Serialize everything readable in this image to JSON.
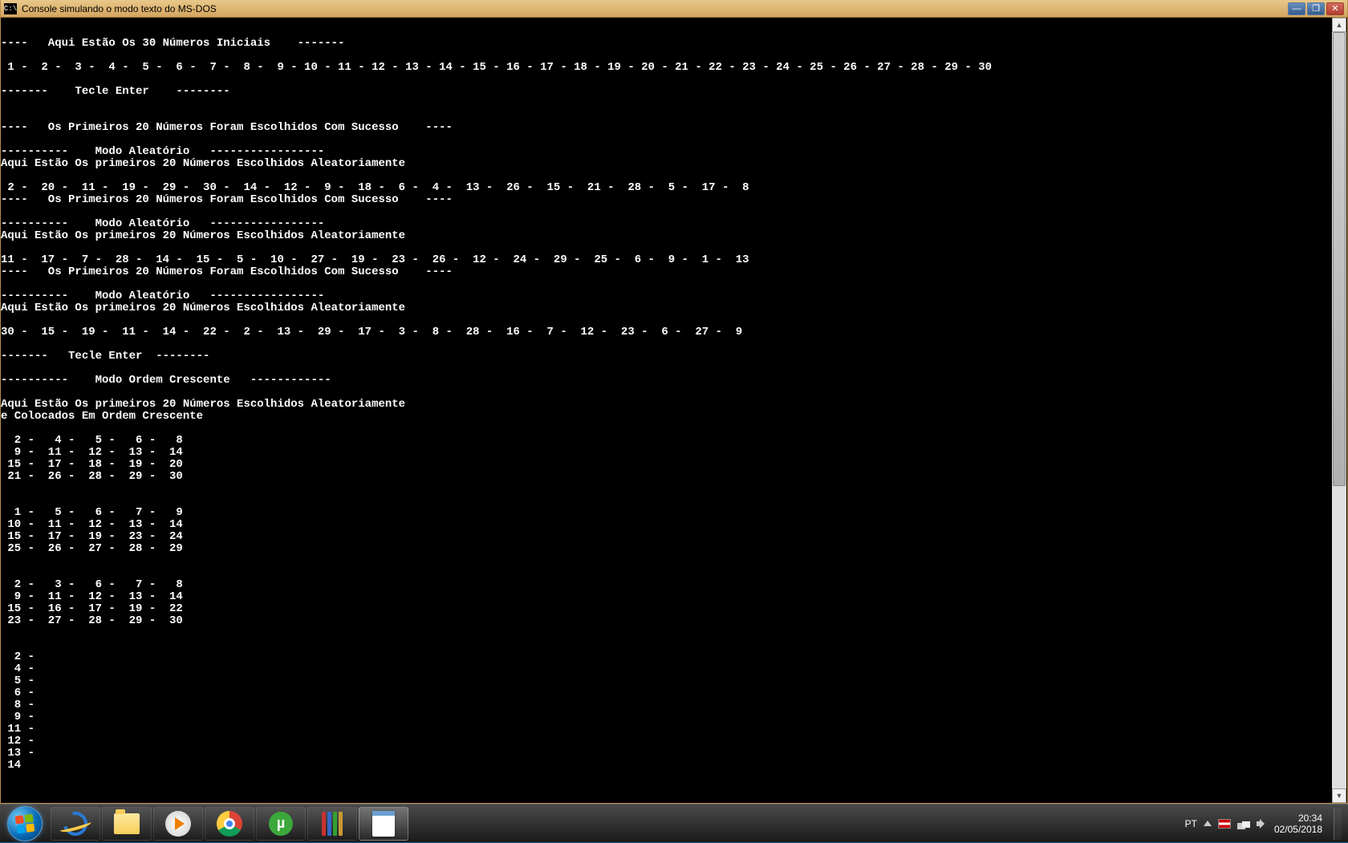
{
  "window": {
    "title": "Console simulando o modo texto do MS-DOS",
    "icon_text": "C:\\",
    "btn_min": "—",
    "btn_max": "❐",
    "btn_close": "✕"
  },
  "console_lines": [
    "",
    "----   Aqui Estão Os 30 Números Iniciais    -------",
    "",
    " 1 -  2 -  3 -  4 -  5 -  6 -  7 -  8 -  9 - 10 - 11 - 12 - 13 - 14 - 15 - 16 - 17 - 18 - 19 - 20 - 21 - 22 - 23 - 24 - 25 - 26 - 27 - 28 - 29 - 30",
    "",
    "-------    Tecle Enter    --------",
    "",
    "",
    "----   Os Primeiros 20 Números Foram Escolhidos Com Sucesso    ----",
    "",
    "----------    Modo Aleatório   -----------------",
    "Aqui Estão Os primeiros 20 Números Escolhidos Aleatoriamente",
    "",
    " 2 -  20 -  11 -  19 -  29 -  30 -  14 -  12 -  9 -  18 -  6 -  4 -  13 -  26 -  15 -  21 -  28 -  5 -  17 -  8",
    "----   Os Primeiros 20 Números Foram Escolhidos Com Sucesso    ----",
    "",
    "----------    Modo Aleatório   -----------------",
    "Aqui Estão Os primeiros 20 Números Escolhidos Aleatoriamente",
    "",
    "11 -  17 -  7 -  28 -  14 -  15 -  5 -  10 -  27 -  19 -  23 -  26 -  12 -  24 -  29 -  25 -  6 -  9 -  1 -  13",
    "----   Os Primeiros 20 Números Foram Escolhidos Com Sucesso    ----",
    "",
    "----------    Modo Aleatório   -----------------",
    "Aqui Estão Os primeiros 20 Números Escolhidos Aleatoriamente",
    "",
    "30 -  15 -  19 -  11 -  14 -  22 -  2 -  13 -  29 -  17 -  3 -  8 -  28 -  16 -  7 -  12 -  23 -  6 -  27 -  9",
    "",
    "-------   Tecle Enter  --------",
    "",
    "----------    Modo Ordem Crescente   ------------",
    "",
    "Aqui Estão Os primeiros 20 Números Escolhidos Aleatoriamente",
    "e Colocados Em Ordem Crescente",
    "",
    "  2 -   4 -   5 -   6 -   8",
    "  9 -  11 -  12 -  13 -  14",
    " 15 -  17 -  18 -  19 -  20",
    " 21 -  26 -  28 -  29 -  30",
    "",
    "",
    "  1 -   5 -   6 -   7 -   9",
    " 10 -  11 -  12 -  13 -  14",
    " 15 -  17 -  19 -  23 -  24",
    " 25 -  26 -  27 -  28 -  29",
    "",
    "",
    "  2 -   3 -   6 -   7 -   8",
    "  9 -  11 -  12 -  13 -  14",
    " 15 -  16 -  17 -  19 -  22",
    " 23 -  27 -  28 -  29 -  30",
    "",
    "",
    "  2 -",
    "  4 -",
    "  5 -",
    "  6 -",
    "  8 -",
    "  9 -",
    " 11 -",
    " 12 -",
    " 13 -",
    " 14"
  ],
  "taskbar": {
    "lang": "PT",
    "time": "20:34",
    "date": "02/05/2018"
  },
  "scrollbar": {
    "up": "▲",
    "down": "▼"
  }
}
